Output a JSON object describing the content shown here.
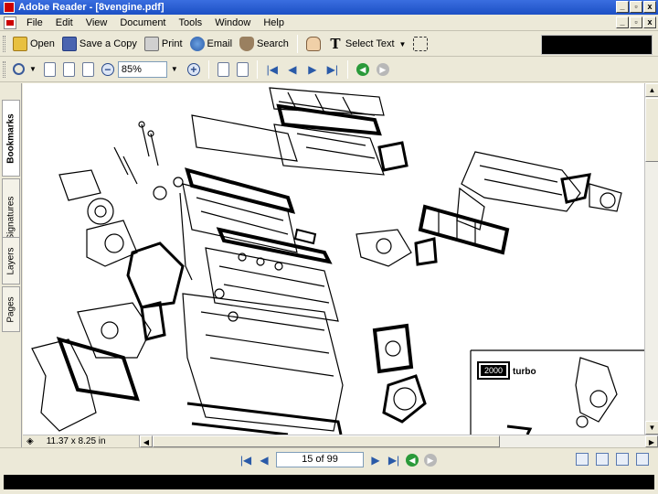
{
  "window": {
    "title": "Adobe Reader - [8vengine.pdf]",
    "controls": [
      "_",
      "▫",
      "x"
    ]
  },
  "menubar": {
    "items": [
      "File",
      "Edit",
      "View",
      "Document",
      "Tools",
      "Window",
      "Help"
    ]
  },
  "toolbar1": {
    "open_label": "Open",
    "save_label": "Save a Copy",
    "print_label": "Print",
    "email_label": "Email",
    "search_label": "Search",
    "select_text_label": "Select Text"
  },
  "toolbar2": {
    "zoom_value": "85%"
  },
  "sidebar": {
    "tabs": [
      "Bookmarks",
      "Signatures",
      "Layers",
      "Pages"
    ]
  },
  "document": {
    "logo_text": "2000",
    "turbo_label": "turbo"
  },
  "status": {
    "page_size": "11.37 x 8.25 in",
    "page_indicator": "15 of 99"
  }
}
